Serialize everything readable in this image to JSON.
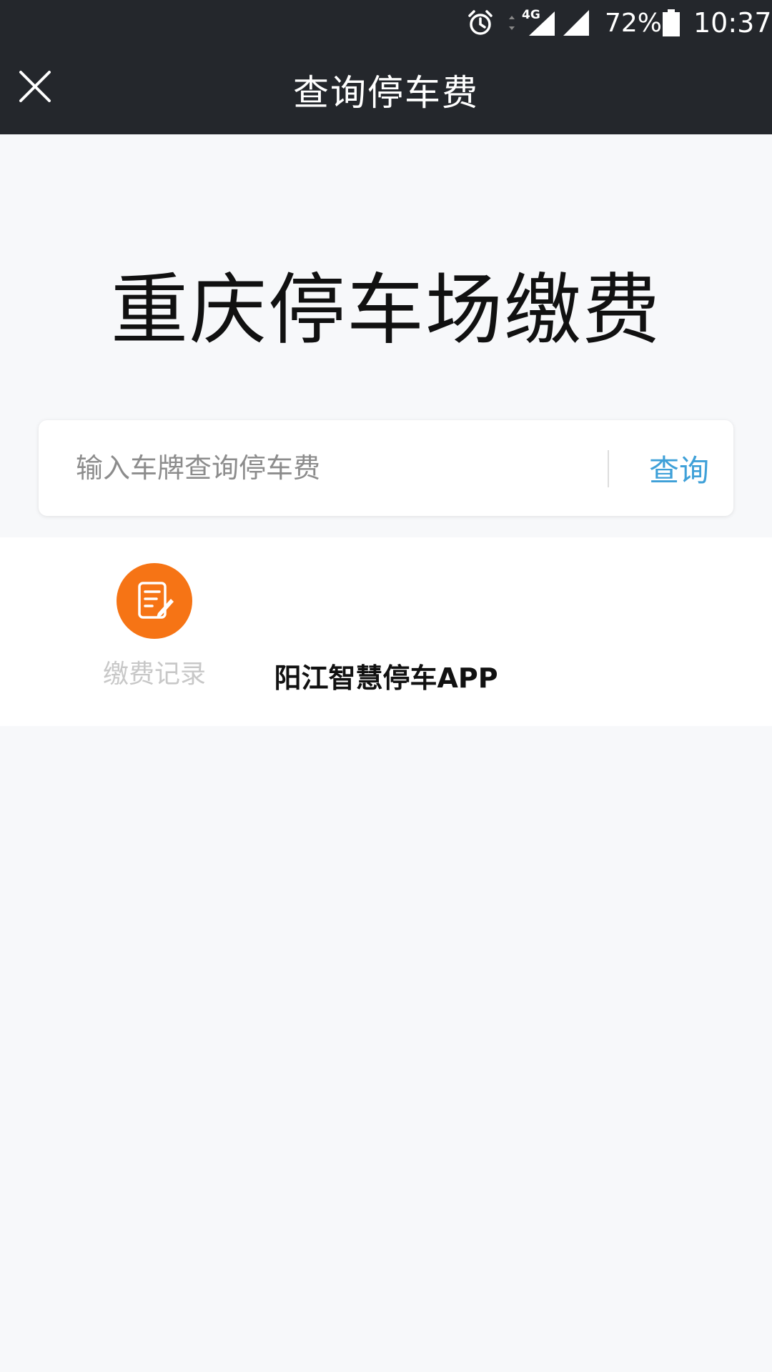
{
  "status_bar": {
    "network": "4G",
    "battery_percent": "72%",
    "time": "10:37"
  },
  "header": {
    "title": "查询停车费"
  },
  "hero": {
    "title": "重庆停车场缴费"
  },
  "search": {
    "placeholder": "输入车牌查询停车费",
    "button_label": "查询",
    "accent_color": "#3ea0d8"
  },
  "shortcuts": [
    {
      "label": "缴费记录",
      "icon": "record-edit-icon",
      "color": "#f67415"
    }
  ],
  "watermark": "阳江智慧停车APP",
  "colors": {
    "header_bg": "#24272c",
    "page_bg": "#f7f8fa"
  }
}
